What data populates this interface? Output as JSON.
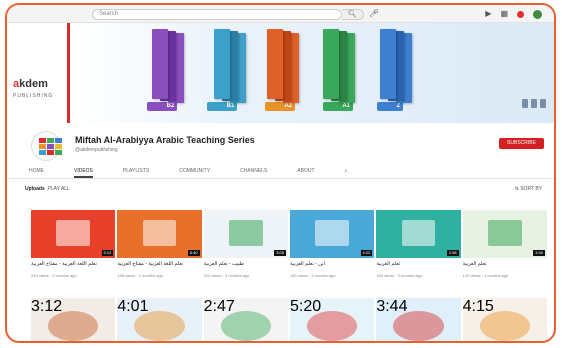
{
  "topbar": {
    "search_placeholder": "Search",
    "search_icon": "search-icon",
    "mic_icon": "mic-icon",
    "icons": [
      "video-camera-icon",
      "apps-icon",
      "bell-icon",
      "avatar"
    ]
  },
  "banner": {
    "logo_text_a": "a",
    "logo_text_rest": "kdem",
    "logo_sub": "PUBLISHING",
    "books": [
      {
        "color": "#8a4fbf",
        "shade": "#6a32a0"
      },
      {
        "color": "#3da0c8",
        "shade": "#2a7fa6"
      },
      {
        "color": "#e0602a",
        "shade": "#bf4515"
      },
      {
        "color": "#3aa85a",
        "shade": "#2a8544"
      },
      {
        "color": "#3d7fd0",
        "shade": "#2a62ae"
      }
    ],
    "levels": [
      {
        "label": "B2",
        "color": "#8a4fbf"
      },
      {
        "label": "B1",
        "color": "#3da0c8"
      },
      {
        "label": "A2",
        "color": "#e8922a"
      },
      {
        "label": "A1",
        "color": "#3aa85a"
      },
      {
        "label": "Z",
        "color": "#3d7fd0"
      }
    ]
  },
  "channel": {
    "name": "Miftah Al-Arabiyya Arabic Teaching Series",
    "handle": "@akdempublishing",
    "subscribe_label": "SUBSCRIBE",
    "logo_colors": [
      "#d92b2b",
      "#3aa85a",
      "#3d7fd0",
      "#e8922a",
      "#8a4fbf",
      "#e8c12a",
      "#3da0c8",
      "#d92b2b",
      "#3aa85a"
    ]
  },
  "tabs": [
    {
      "label": "Home",
      "active": false
    },
    {
      "label": "Videos",
      "active": true
    },
    {
      "label": "Playlists",
      "active": false
    },
    {
      "label": "Community",
      "active": false
    },
    {
      "label": "Channels",
      "active": false
    },
    {
      "label": "About",
      "active": false
    }
  ],
  "tab_search_icon": "search-icon",
  "section": {
    "title": "Uploads",
    "play_all": "PLAY ALL",
    "sort_label": "SORT BY"
  },
  "videos_row1": [
    {
      "title": "تعلم اللغة العربية - مفتاح العربية",
      "meta": "245 views · 2 months ago",
      "duration": "5:12",
      "bg": "#e8402a",
      "accent": "#ffffff"
    },
    {
      "title": "تعلم اللغة العربية - مفتاح العربية",
      "meta": "198 views · 2 months ago",
      "duration": "6:40",
      "bg": "#e8702a",
      "accent": "#ffffff"
    },
    {
      "title": "طبيب - تعلم العربية",
      "meta": "312 views · 3 months ago",
      "duration": "3:05",
      "bg": "#eef3f8",
      "accent": "#3aa85a"
    },
    {
      "title": "أين - تعلم العربية",
      "meta": "180 views · 3 months ago",
      "duration": "4:22",
      "bg": "#4aa8d8",
      "accent": "#ffffff"
    },
    {
      "title": "تعلم العربية",
      "meta": "150 views · 3 months ago",
      "duration": "2:58",
      "bg": "#2fb0a0",
      "accent": "#ffffff"
    },
    {
      "title": "تعلم العربية",
      "meta": "120 views · 4 months ago",
      "duration": "3:30",
      "bg": "#e8f2e4",
      "accent": "#3aa85a"
    }
  ],
  "videos_row2": [
    {
      "duration": "3:12",
      "bg": "#f1ede6",
      "accent": "#c85a2a"
    },
    {
      "duration": "4:01",
      "bg": "#e8f0f8",
      "accent": "#e8922a"
    },
    {
      "duration": "2:47",
      "bg": "#f4f4f4",
      "accent": "#3aa85a"
    },
    {
      "duration": "5:20",
      "bg": "#e6f4fa",
      "accent": "#e03030"
    },
    {
      "duration": "3:44",
      "bg": "#dff0fa",
      "accent": "#d92b2b"
    },
    {
      "duration": "4:15",
      "bg": "#f6f0e8",
      "accent": "#e8922a"
    }
  ],
  "colors": {
    "accent": "#e8602c",
    "subscribe": "#d32020",
    "redbar": "#d92b2b"
  }
}
